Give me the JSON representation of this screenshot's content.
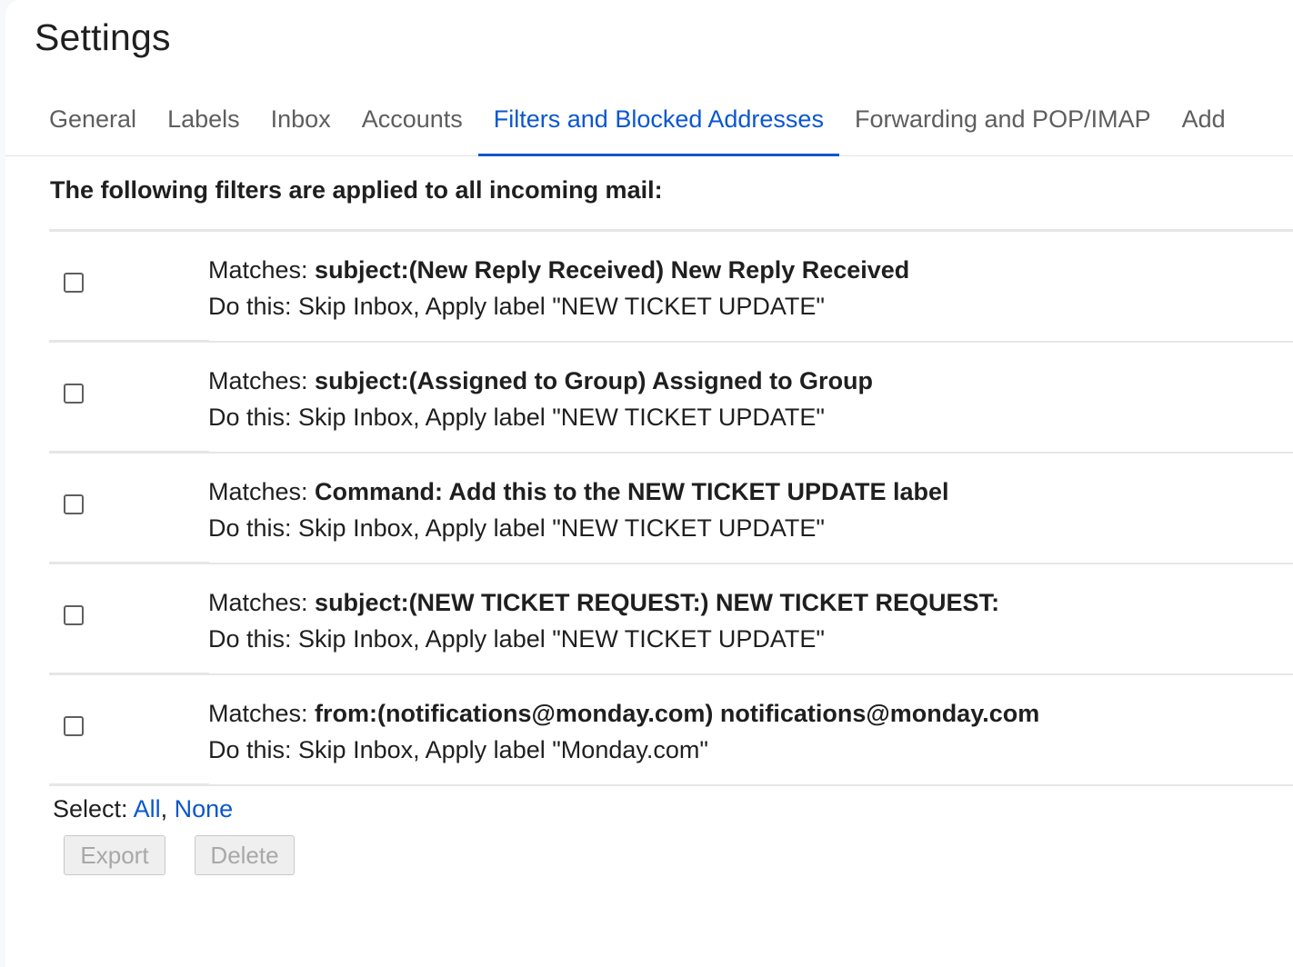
{
  "page": {
    "title": "Settings"
  },
  "tabs": [
    {
      "label": "General",
      "active": false
    },
    {
      "label": "Labels",
      "active": false
    },
    {
      "label": "Inbox",
      "active": false
    },
    {
      "label": "Accounts",
      "active": false
    },
    {
      "label": "Filters and Blocked Addresses",
      "active": true
    },
    {
      "label": "Forwarding and POP/IMAP",
      "active": false
    },
    {
      "label": "Add",
      "active": false
    }
  ],
  "filters": {
    "intro": "The following filters are applied to all incoming mail:",
    "matches_prefix": "Matches: ",
    "action_prefix": "Do this: ",
    "rows": [
      {
        "criteria": "subject:(New Reply Received) New Reply Received",
        "action": "Skip Inbox, Apply label \"NEW TICKET UPDATE\""
      },
      {
        "criteria": "subject:(Assigned to Group) Assigned to Group",
        "action": "Skip Inbox, Apply label \"NEW TICKET UPDATE\""
      },
      {
        "criteria": "Command: Add this to the NEW TICKET UPDATE label",
        "action": "Skip Inbox, Apply label \"NEW TICKET UPDATE\""
      },
      {
        "criteria": "subject:(NEW TICKET REQUEST:) NEW TICKET REQUEST:",
        "action": "Skip Inbox, Apply label \"NEW TICKET UPDATE\""
      },
      {
        "criteria": "from:(notifications@monday.com) notifications@monday.com",
        "action": "Skip Inbox, Apply label \"Monday.com\""
      }
    ]
  },
  "selection": {
    "label": "Select: ",
    "all": "All",
    "separator": ", ",
    "none": "None"
  },
  "actions": {
    "export_label": "Export",
    "delete_label": "Delete"
  },
  "colors": {
    "accent": "#0b57d0",
    "text": "#1f1f1f",
    "muted": "#5e5e5e",
    "divider": "#e6e6e6"
  }
}
